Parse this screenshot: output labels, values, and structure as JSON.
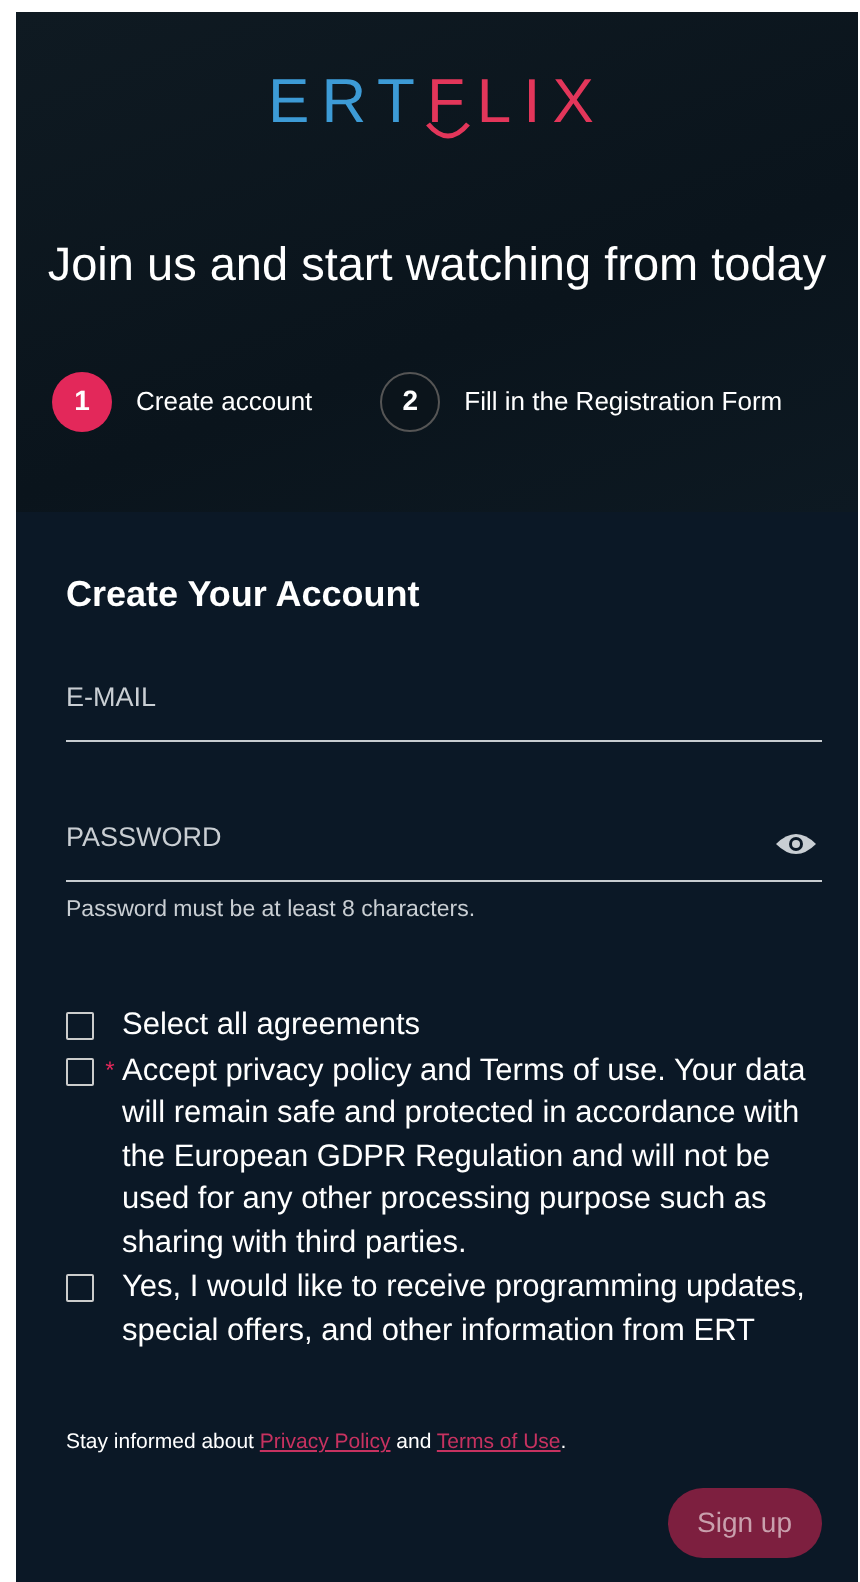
{
  "logo": {
    "part_1": "ERT",
    "part_2": "FLIX"
  },
  "headline": "Join us and start watching from today",
  "steps": [
    {
      "number": "1",
      "label": "Create account",
      "selected": true
    },
    {
      "number": "2",
      "label": "Fill in the Registration Form",
      "selected": false
    }
  ],
  "form": {
    "title": "Create Your Account",
    "fields": [
      {
        "kind": "email",
        "placeholder": "E-MAIL"
      },
      {
        "kind": "password",
        "placeholder": "PASSWORD",
        "hint": "Password must be at least 8 characters."
      }
    ],
    "agreements": [
      {
        "label": "Select all agreements",
        "checked": false
      },
      {
        "label": "Accept privacy policy and Terms of use. Your data will remain safe and protected in accordance with the European GDPR Regulation and will not be used for any other processing purpose such as sharing with third parties.",
        "checked": false,
        "required_mark": "*"
      },
      {
        "label": "Yes, I would like to receive programming updates, special offers, and other information from ERT",
        "checked": false
      }
    ],
    "notice": {
      "before": "Stay informed about",
      "link_1": "Privacy Policy",
      "middle": "and",
      "link_2": "Terms of Use",
      "after": "."
    },
    "submit": {
      "label": "Sign up",
      "disabled": true
    }
  }
}
